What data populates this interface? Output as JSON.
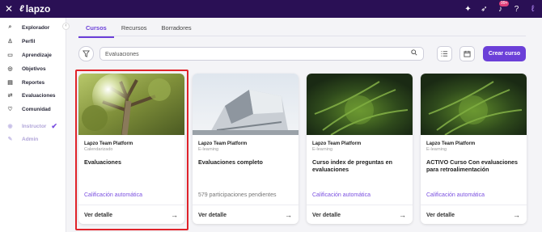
{
  "app": {
    "name": "lapzo",
    "close_glyph": "✕",
    "notification_count": "99+"
  },
  "sidebar": {
    "collapse_glyph": "‹",
    "items": [
      {
        "label": "Explorador",
        "icon": "search-icon",
        "glyph": "⌕"
      },
      {
        "label": "Perfil",
        "icon": "user-icon",
        "glyph": "♙"
      },
      {
        "label": "Aprendizaje",
        "icon": "book-icon",
        "glyph": "▭"
      },
      {
        "label": "Objetivos",
        "icon": "target-icon",
        "glyph": "◎"
      },
      {
        "label": "Reportes",
        "icon": "chart-icon",
        "glyph": "▤"
      },
      {
        "label": "Evaluaciones",
        "icon": "swap-icon",
        "glyph": "⇄"
      },
      {
        "label": "Comunidad",
        "icon": "heart-icon",
        "glyph": "♡"
      },
      {
        "label": "Instructor",
        "icon": "instructor-icon",
        "glyph": "◉",
        "dim": true
      },
      {
        "label": "Admin",
        "icon": "admin-icon",
        "glyph": "✎",
        "dim": true
      }
    ]
  },
  "tabs": [
    {
      "label": "Cursos",
      "active": true
    },
    {
      "label": "Recursos",
      "active": false
    },
    {
      "label": "Borradores",
      "active": false
    }
  ],
  "search": {
    "placeholder": "Evaluaciones"
  },
  "toolbar": {
    "create_label": "Crear curso"
  },
  "cards": [
    {
      "org": "Lapzo Team Platform",
      "type": "Calendarizado",
      "title": "Evaluaciones",
      "meta": "Calificación automática",
      "meta_style": "accent",
      "detail": "Ver detalle",
      "image": "tree"
    },
    {
      "org": "Lapzo Team Platform",
      "type": "E-learning",
      "title": "Evaluaciones completo",
      "meta": "579 participaciones pendientes",
      "meta_style": "grey",
      "detail": "Ver detalle",
      "image": "building"
    },
    {
      "org": "Lapzo Team Platform",
      "type": "E-learning",
      "title": "Curso index de preguntas en evaluaciones",
      "meta": "Calificación automática",
      "meta_style": "accent",
      "detail": "Ver detalle",
      "image": "fern"
    },
    {
      "org": "Lapzo Team Platform",
      "type": "E-learning",
      "title": "ACTIVO Curso Con evaluaciones para retroalimentación",
      "meta": "Calificación automática",
      "meta_style": "accent",
      "detail": "Ver detalle",
      "image": "fern"
    }
  ],
  "colors": {
    "topbar": "#2a1055",
    "accent": "#6b3fd8",
    "highlight": "#e0232a"
  }
}
